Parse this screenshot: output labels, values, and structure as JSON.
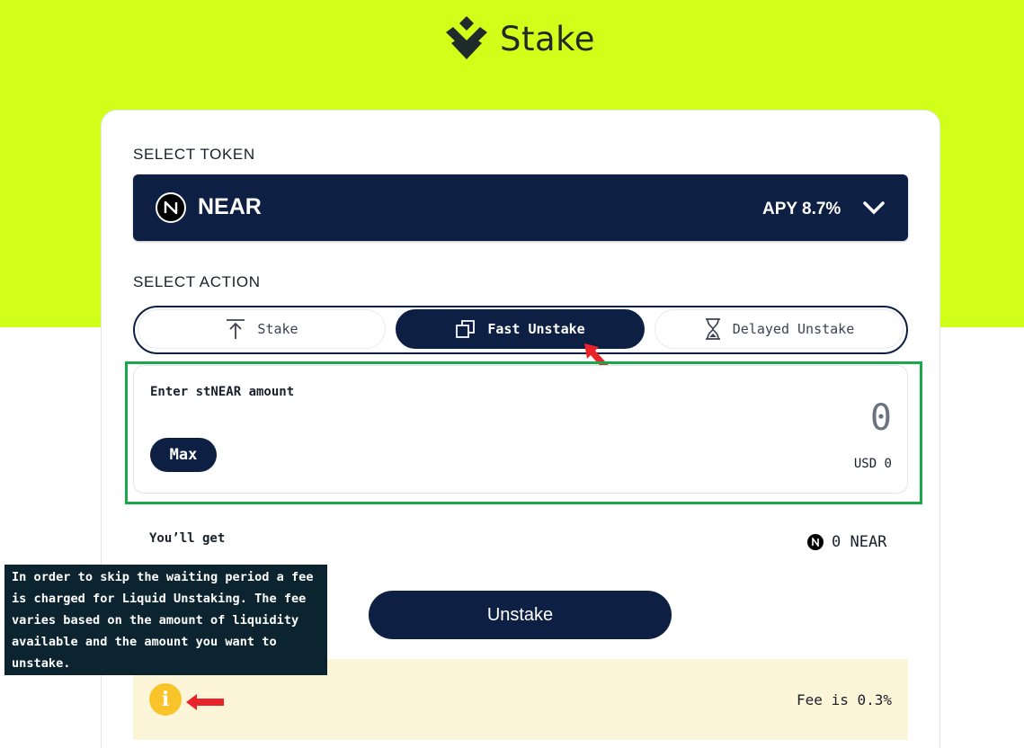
{
  "brand": {
    "name": "Stake",
    "logo_icon": "stack-chevron-icon"
  },
  "token_section": {
    "label": "SELECT TOKEN",
    "selected_token": "NEAR",
    "apy": "APY 8.7%",
    "token_icon": "near-logo-icon",
    "dropdown_icon": "chevron-down-icon"
  },
  "action_section": {
    "label": "SELECT ACTION",
    "tabs": [
      {
        "label": "Stake",
        "icon": "arrow-up-icon",
        "active": false
      },
      {
        "label": "Fast Unstake",
        "icon": "copy-squares-icon",
        "active": true
      },
      {
        "label": "Delayed Unstake",
        "icon": "hourglass-icon",
        "active": false
      }
    ]
  },
  "amount": {
    "label": "Enter stNEAR amount",
    "placeholder": "0",
    "max_label": "Max",
    "usd": "USD 0"
  },
  "receive": {
    "label": "You’ll get",
    "value": "0 NEAR"
  },
  "unstake_button": "Unstake",
  "fee": {
    "text": "Fee is 0.3%",
    "tooltip": "In order to skip the waiting period a fee is charged for Liquid Unstaking. The fee varies based on the amount of liquidity available and the amount you want to unstake."
  },
  "colors": {
    "hero": "#d2ff1a",
    "navy": "#0e1f44",
    "highlight": "#1aa94a",
    "annotation_arrow": "#e8232a",
    "fee_bg": "#fdf5d8",
    "info": "#f8c42a"
  }
}
